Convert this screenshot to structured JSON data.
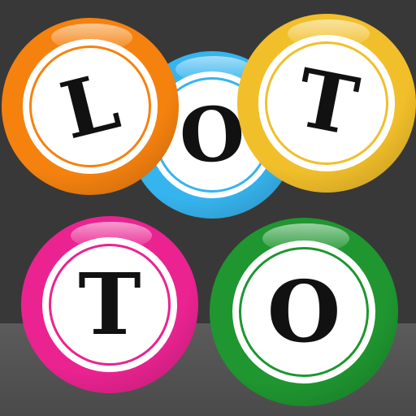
{
  "app": {
    "name": "Lotto"
  },
  "balls": [
    {
      "id": "o-blue",
      "letter": "O",
      "color": "#36b4ee"
    },
    {
      "id": "l-orange",
      "letter": "L",
      "color": "#f5820f"
    },
    {
      "id": "t-yellow",
      "letter": "T",
      "color": "#f1bf2a"
    },
    {
      "id": "t-pink",
      "letter": "T",
      "color": "#ea2391"
    },
    {
      "id": "o-green",
      "letter": "O",
      "color": "#1f9630"
    }
  ],
  "colors": {
    "background": "#383838",
    "floor": "#555555",
    "letter": "#111111"
  }
}
